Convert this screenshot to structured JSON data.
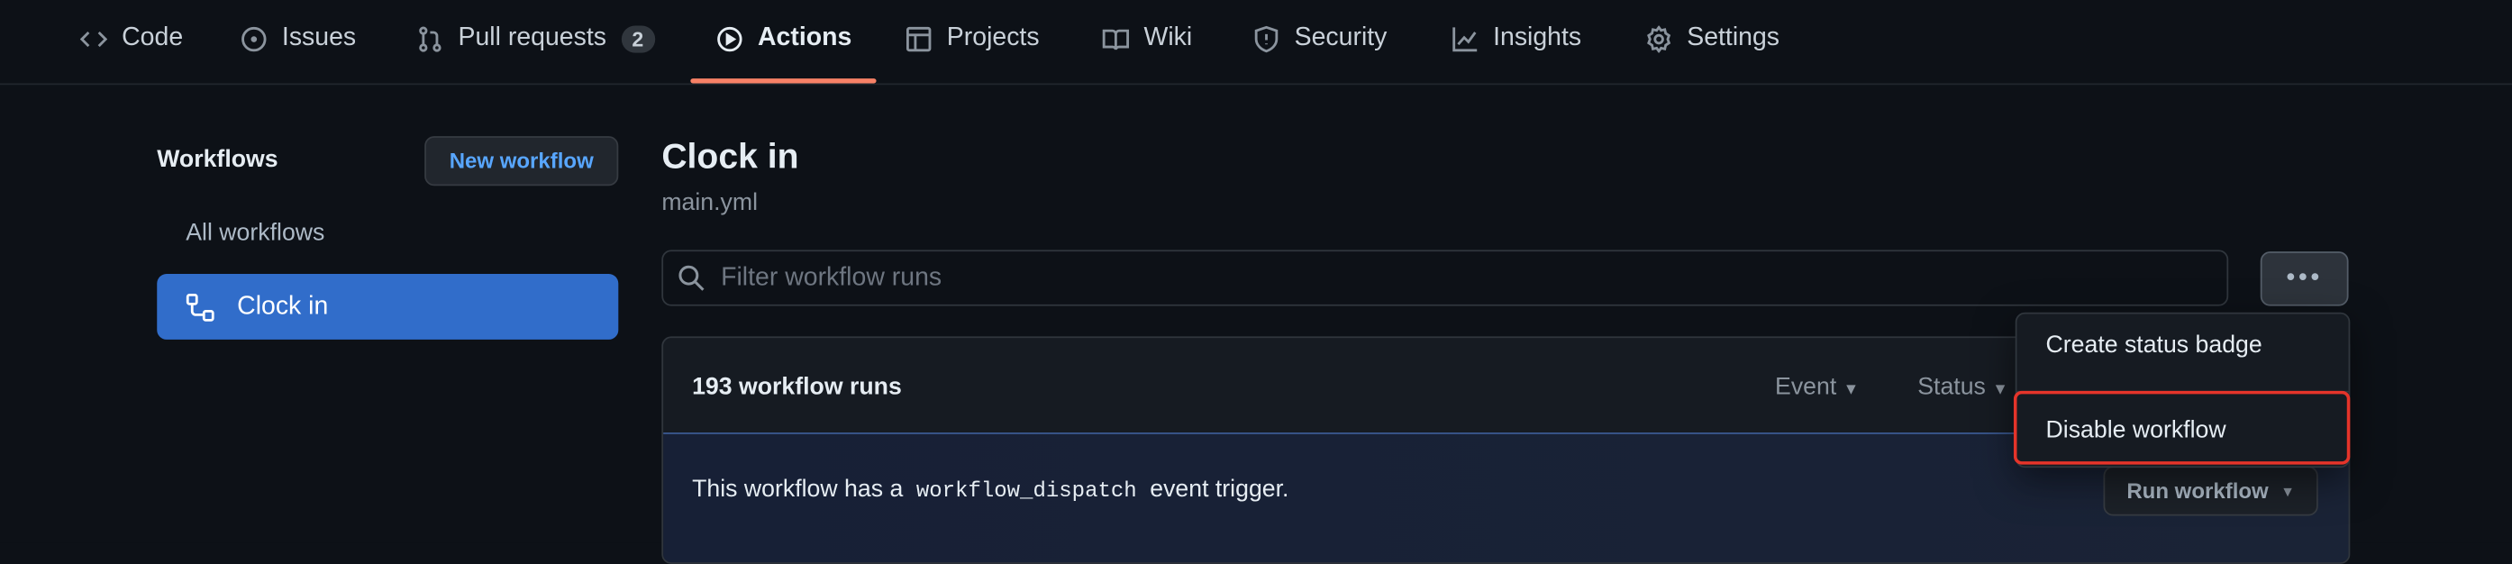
{
  "nav": {
    "items": [
      {
        "label": "Code",
        "icon": "code-icon"
      },
      {
        "label": "Issues",
        "icon": "issue-icon"
      },
      {
        "label": "Pull requests",
        "icon": "pull-request-icon",
        "count": "2"
      },
      {
        "label": "Actions",
        "icon": "play-icon",
        "active": true
      },
      {
        "label": "Projects",
        "icon": "table-icon"
      },
      {
        "label": "Wiki",
        "icon": "book-icon"
      },
      {
        "label": "Security",
        "icon": "shield-icon"
      },
      {
        "label": "Insights",
        "icon": "graph-icon"
      },
      {
        "label": "Settings",
        "icon": "gear-icon"
      }
    ],
    "active_color": "#f78166"
  },
  "sidebar": {
    "title": "Workflows",
    "new_workflow": "New workflow",
    "items": [
      {
        "label": "All workflows"
      },
      {
        "label": "Clock in",
        "selected": true,
        "icon": "workflow-icon"
      }
    ],
    "selected_color": "#316dca"
  },
  "main": {
    "title": "Clock in",
    "file": "main.yml",
    "filter_placeholder": "Filter workflow runs",
    "runs_count": "193 workflow runs",
    "filters": {
      "event": "Event",
      "status": "Status"
    },
    "banner": {
      "prefix": "This workflow has a",
      "code": "workflow_dispatch",
      "suffix": "event trigger."
    },
    "run_workflow": "Run workflow"
  },
  "menu": {
    "items": [
      {
        "label": "Create status badge"
      },
      {
        "label": "Disable workflow",
        "highlighted": true
      }
    ],
    "highlight_color": "#e5342a"
  }
}
